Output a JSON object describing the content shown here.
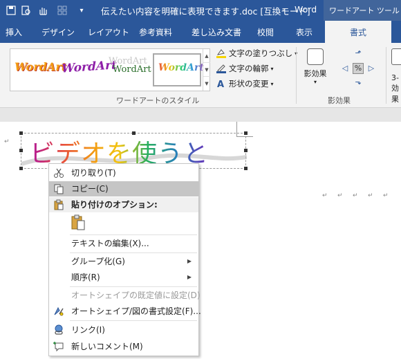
{
  "titlebar": {
    "doc_title": "伝えたい内容を明確に表現できます.doc [互換モード]",
    "dash": "-",
    "app_name": "Word",
    "context_title": "ワードアート ツール",
    "qat_icons": [
      "save-icon",
      "print-preview-icon",
      "touch-mode-icon",
      "layout-icon",
      "customize-icon"
    ]
  },
  "tabs": [
    "挿入",
    "デザイン",
    "レイアウト",
    "参考資料",
    "差し込み文書",
    "校閲",
    "表示",
    "書式"
  ],
  "ribbon": {
    "gallery_items": [
      "WordArt",
      "WordArt",
      "WordArt",
      "WordArt",
      "WordArt"
    ],
    "fill_label": "文字の塗りつぶし",
    "outline_label": "文字の輪郭",
    "shape_change_label": "形状の変更",
    "group_label": "ワードアートのスタイル",
    "shadow_label": "影効果",
    "shadow_group_label": "影効果",
    "cut_label_1": "3-",
    "cut_label_2": "効果",
    "colors": {
      "fill_bar": "#f5d400",
      "outline_bar": "#2b579a"
    }
  },
  "document": {
    "wordart_text": "ビデオを使うと",
    "paragraph_mark": "↵"
  },
  "context_menu": {
    "cut": "切り取り(T)",
    "copy": "コピー(C)",
    "paste_options": "貼り付けのオプション:",
    "edit_text": "テキストの編集(X)...",
    "group": "グループ化(G)",
    "order": "順序(R)",
    "set_default": "オートシェイプの既定値に設定(D)",
    "format_shape": "オートシェイプ/図の書式設定(F)...",
    "link": "リンク(I)",
    "new_comment": "新しいコメント(M)"
  }
}
